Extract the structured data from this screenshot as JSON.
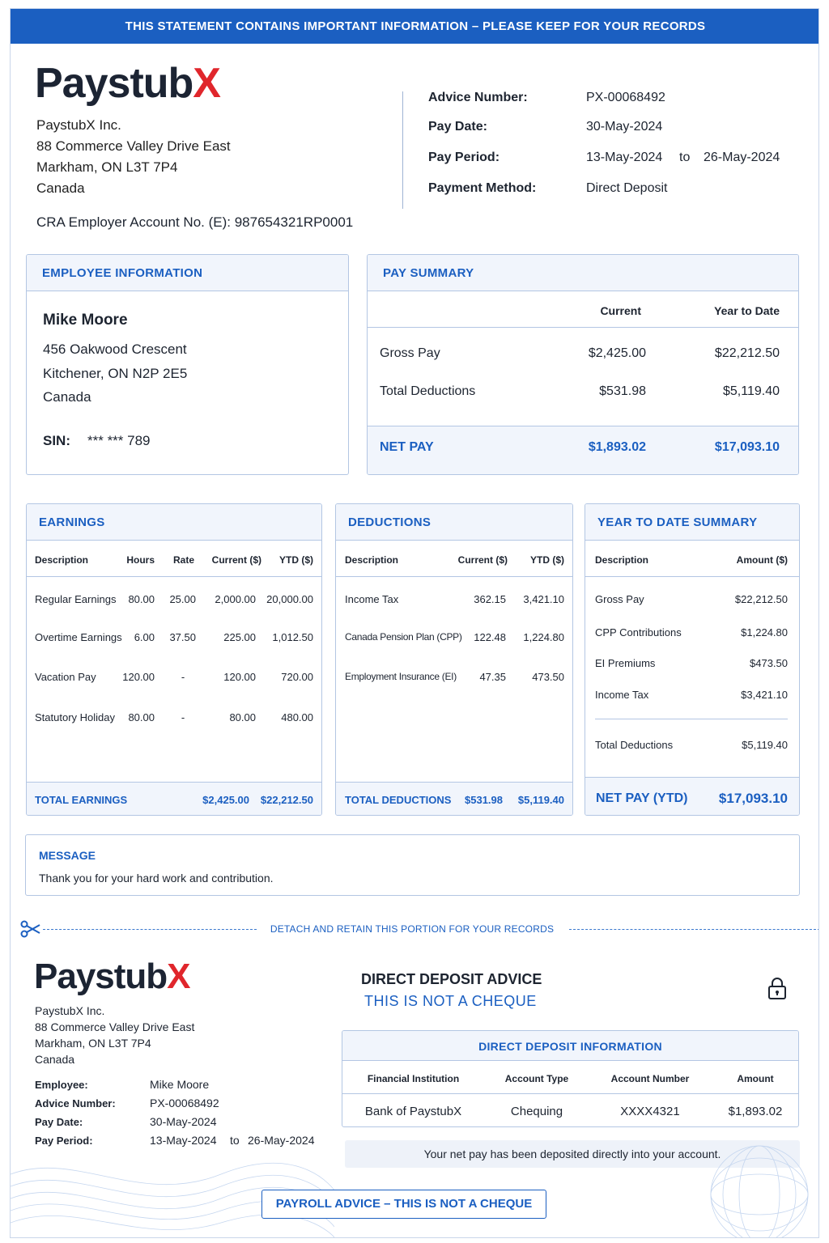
{
  "banner": "THIS STATEMENT CONTAINS IMPORTANT INFORMATION – PLEASE KEEP FOR YOUR RECORDS",
  "company": {
    "logo_main": "Paystub",
    "logo_x": "X",
    "name": "PaystubX Inc.",
    "address1": "88 Commerce Valley Drive East",
    "address2": "Markham, ON  L3T 7P4",
    "country": "Canada",
    "cra": "CRA Employer Account No. (E): 987654321RP0001"
  },
  "advice": {
    "number_label": "Advice Number:",
    "number": "PX-00068492",
    "date_label": "Pay Date:",
    "date": "30-May-2024",
    "period_label": "Pay Period:",
    "period_start": "13-May-2024",
    "period_to": "to",
    "period_end": "26-May-2024",
    "method_label": "Payment Method:",
    "method": "Direct Deposit"
  },
  "employee": {
    "heading": "EMPLOYEE INFORMATION",
    "name": "Mike Moore",
    "address1": "456 Oakwood Crescent",
    "address2": "Kitchener, ON  N2P 2E5",
    "country": "Canada",
    "sin_label": "SIN:",
    "sin": "*** *** 789"
  },
  "pay_summary": {
    "heading": "PAY SUMMARY",
    "col_current": "Current",
    "col_ytd": "Year to Date",
    "rows": [
      {
        "label": "Gross Pay",
        "current": "$2,425.00",
        "ytd": "$22,212.50"
      },
      {
        "label": "Total Deductions",
        "current": "$531.98",
        "ytd": "$5,119.40"
      }
    ],
    "net_label": "NET PAY",
    "net_current": "$1,893.02",
    "net_ytd": "$17,093.10"
  },
  "earnings": {
    "heading": "EARNINGS",
    "cols": [
      "Description",
      "Hours",
      "Rate",
      "Current ($)",
      "YTD ($)"
    ],
    "rows": [
      {
        "desc": "Regular Earnings",
        "hours": "80.00",
        "rate": "25.00",
        "current": "2,000.00",
        "ytd": "20,000.00"
      },
      {
        "desc": "Overtime Earnings",
        "hours": "6.00",
        "rate": "37.50",
        "current": "225.00",
        "ytd": "1,012.50"
      },
      {
        "desc": "Vacation Pay",
        "hours": "120.00",
        "rate": "-",
        "current": "120.00",
        "ytd": "720.00"
      },
      {
        "desc": "Statutory Holiday",
        "hours": "80.00",
        "rate": "-",
        "current": "80.00",
        "ytd": "480.00"
      }
    ],
    "total_label": "TOTAL EARNINGS",
    "total_current": "$2,425.00",
    "total_ytd": "$22,212.50"
  },
  "deductions": {
    "heading": "DEDUCTIONS",
    "cols": [
      "Description",
      "Current ($)",
      "YTD ($)"
    ],
    "rows": [
      {
        "desc": "Income Tax",
        "current": "362.15",
        "ytd": "3,421.10"
      },
      {
        "desc": "Canada Pension Plan (CPP)",
        "current": "122.48",
        "ytd": "1,224.80"
      },
      {
        "desc": "Employment Insurance (EI)",
        "current": "47.35",
        "ytd": "473.50"
      }
    ],
    "total_label": "TOTAL DEDUCTIONS",
    "total_current": "$531.98",
    "total_ytd": "$5,119.40"
  },
  "ytd_summary": {
    "heading": "YEAR TO DATE SUMMARY",
    "cols": [
      "Description",
      "Amount ($)"
    ],
    "rows": [
      {
        "desc": "Gross Pay",
        "amount": "$22,212.50"
      },
      {
        "desc": "CPP Contributions",
        "amount": "$1,224.80"
      },
      {
        "desc": "EI Premiums",
        "amount": "$473.50"
      },
      {
        "desc": "Income Tax",
        "amount": "$3,421.10"
      }
    ],
    "total_label": "Total Deductions",
    "total_amount": "$5,119.40",
    "net_label": "NET PAY (YTD)",
    "net_amount": "$17,093.10"
  },
  "message": {
    "heading": "MESSAGE",
    "text": "Thank you for your hard work and contribution."
  },
  "detach": "DETACH AND RETAIN THIS PORTION FOR YOUR RECORDS",
  "stub": {
    "title": "DIRECT DEPOSIT ADVICE",
    "subtitle": "THIS IS NOT A CHEQUE",
    "employee_label": "Employee:",
    "employee": "Mike Moore",
    "advice_label": "Advice Number:",
    "advice": "PX-00068492",
    "date_label": "Pay Date:",
    "date": "30-May-2024",
    "period_label": "Pay Period:",
    "period_start": "13-May-2024",
    "period_to": "to",
    "period_end": "26-May-2024",
    "dd_heading": "DIRECT DEPOSIT INFORMATION",
    "dd_cols": [
      "Financial Institution",
      "Account Type",
      "Account Number",
      "Amount"
    ],
    "dd_row": {
      "institution": "Bank of PaystubX",
      "type": "Chequing",
      "account": "XXXX4321",
      "amount": "$1,893.02"
    },
    "deposit_note": "Your net pay has been deposited directly into your account.",
    "button": "PAYROLL ADVICE – THIS IS NOT A CHEQUE"
  },
  "icons": [
    "scissors-icon",
    "lock-icon"
  ],
  "colors": {
    "accent": "#1b5fc1",
    "logo_x": "#e0262c"
  }
}
